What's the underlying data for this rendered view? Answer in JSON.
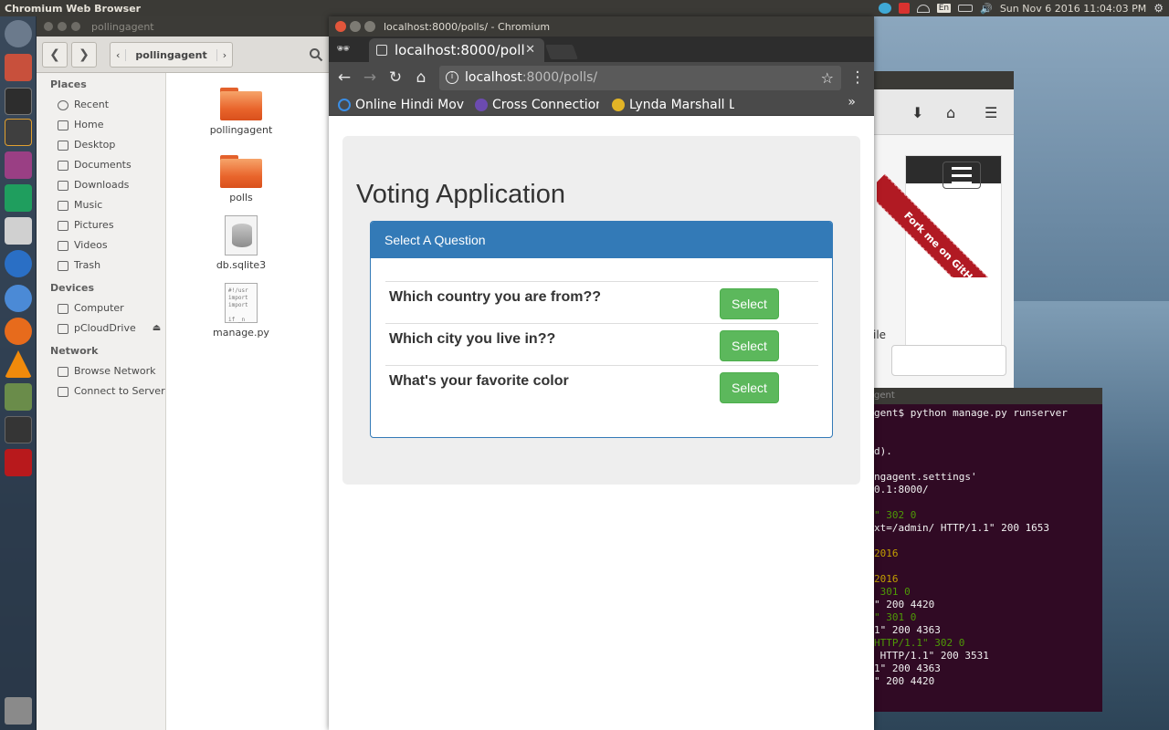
{
  "top_panel": {
    "app_title": "Chromium Web Browser",
    "keyboard_layout": "En",
    "clock": "Sun Nov  6 2016 11:04:03 PM"
  },
  "launcher": {
    "items": [
      "ubuntu-dash-icon",
      "files-icon",
      "terminal-icon",
      "sublime-text-icon",
      "software-center-icon",
      "pycharm-icon",
      "disks-icon",
      "r-icon",
      "chromium-icon",
      "firefox-icon",
      "vlc-icon",
      "system-monitor-icon",
      "workspace-switcher-icon",
      "filezilla-icon",
      "trash-icon"
    ]
  },
  "file_manager": {
    "window_title": "pollingagent",
    "path": {
      "current": "pollingagent"
    },
    "sidebar": {
      "places_header": "Places",
      "places": [
        "Recent",
        "Home",
        "Desktop",
        "Documents",
        "Downloads",
        "Music",
        "Pictures",
        "Videos",
        "Trash"
      ],
      "devices_header": "Devices",
      "devices": [
        "Computer",
        "pCloudDrive"
      ],
      "network_header": "Network",
      "network": [
        "Browse Network",
        "Connect to Server"
      ]
    },
    "files": [
      "pollingagent",
      "polls",
      "db.sqlite3",
      "manage.py"
    ]
  },
  "browser": {
    "window_title": "localhost:8000/polls/ - Chromium",
    "tab_title": "localhost:8000/poll",
    "url_host": "localhost",
    "url_path": ":8000/polls/",
    "bookmarks": [
      "Online Hindi Mov",
      "Cross Connection",
      "Lynda Marshall L"
    ],
    "page": {
      "heading": "Voting Application",
      "panel_title": "Select A Question",
      "questions": [
        {
          "text": "Which country you are from??",
          "button": "Select"
        },
        {
          "text": "Which city you live in??",
          "button": "Select"
        },
        {
          "text": "What's your favorite color",
          "button": "Select"
        }
      ]
    }
  },
  "background_window": {
    "ribbon_text": "Fork me on GitHub",
    "partial_label": "ile"
  },
  "terminal": {
    "title": "gent",
    "lines": [
      "gent$ python manage.py runserver",
      "",
      "",
      "d).",
      "",
      "ngagent.settings'",
      "0.1:8000/",
      "",
      "\" 302 0",
      "xt=/admin/ HTTP/1.1\" 200 1653",
      "",
      "2016",
      "",
      "2016",
      " 301 0",
      "\" 200 4420",
      "\" 301 0",
      "1\" 200 4363",
      "HTTP/1.1\" 302 0",
      " HTTP/1.1\" 200 3531",
      "1\" 200 4363",
      "\" 200 4420"
    ]
  }
}
